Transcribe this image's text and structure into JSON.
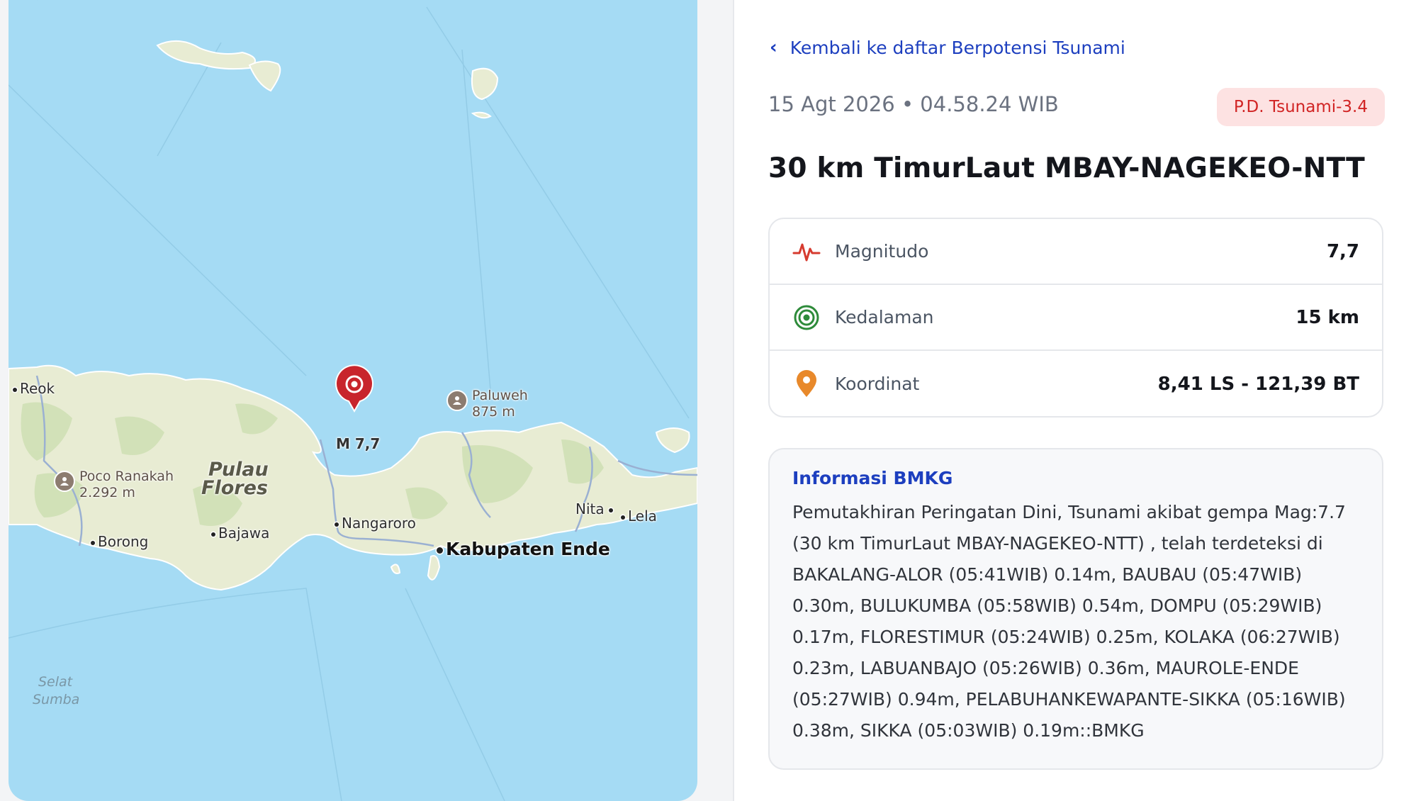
{
  "map": {
    "quake_label": "M 7,7",
    "towns": [
      {
        "name": "Reok"
      },
      {
        "name": "Borong"
      },
      {
        "name": "Bajawa"
      },
      {
        "name": "Nangaroro"
      },
      {
        "name": "Nita"
      },
      {
        "name": "Lela"
      }
    ],
    "city": "Kabupaten Ende",
    "island_line1": "Pulau",
    "island_line2": "Flores",
    "strait_line1": "Selat",
    "strait_line2": "Sumba",
    "peaks": [
      {
        "name": "Poco Ranakah",
        "height": "2.292 m"
      },
      {
        "name": "Paluweh",
        "height": "875 m"
      }
    ],
    "colors": {
      "sea": "#a5dbf4",
      "land": "#e8ecd3",
      "forest": "#cfe0b5",
      "pin": "#c8252c"
    }
  },
  "panel": {
    "back_label": "Kembali ke daftar Berpotensi Tsunami",
    "datetime": "15 Agt 2026 • 04.58.24 WIB",
    "badge": "P.D. Tsunami-3.4",
    "title": "30 km TimurLaut MBAY-NAGEKEO-NTT",
    "stats": [
      {
        "icon": "waveform-icon",
        "label": "Magnitudo",
        "value": "7,7",
        "color": "#d63b2f"
      },
      {
        "icon": "target-icon",
        "label": "Kedalaman",
        "value": "15 km",
        "color": "#2e8b3a"
      },
      {
        "icon": "location-pin-icon",
        "label": "Koordinat",
        "value": "8,41 LS - 121,39 BT",
        "color": "#e8892b"
      }
    ],
    "info_title": "Informasi BMKG",
    "info_body": "Pemutakhiran Peringatan Dini, Tsunami akibat gempa Mag:7.7 (30 km TimurLaut MBAY-NAGEKEO-NTT) , telah terdeteksi di BAKALANG-ALOR (05:41WIB) 0.14m, BAUBAU (05:47WIB) 0.30m, BULUKUMBA (05:58WIB) 0.54m, DOMPU (05:29WIB) 0.17m, FLORESTIMUR (05:24WIB) 0.25m, KOLAKA (06:27WIB) 0.23m, LABUANBAJO (05:26WIB) 0.36m, MAUROLE-ENDE (05:27WIB) 0.94m, PELABUHANKEWAPANTE-SIKKA (05:16WIB) 0.38m, SIKKA (05:03WIB) 0.19m::BMKG"
  }
}
